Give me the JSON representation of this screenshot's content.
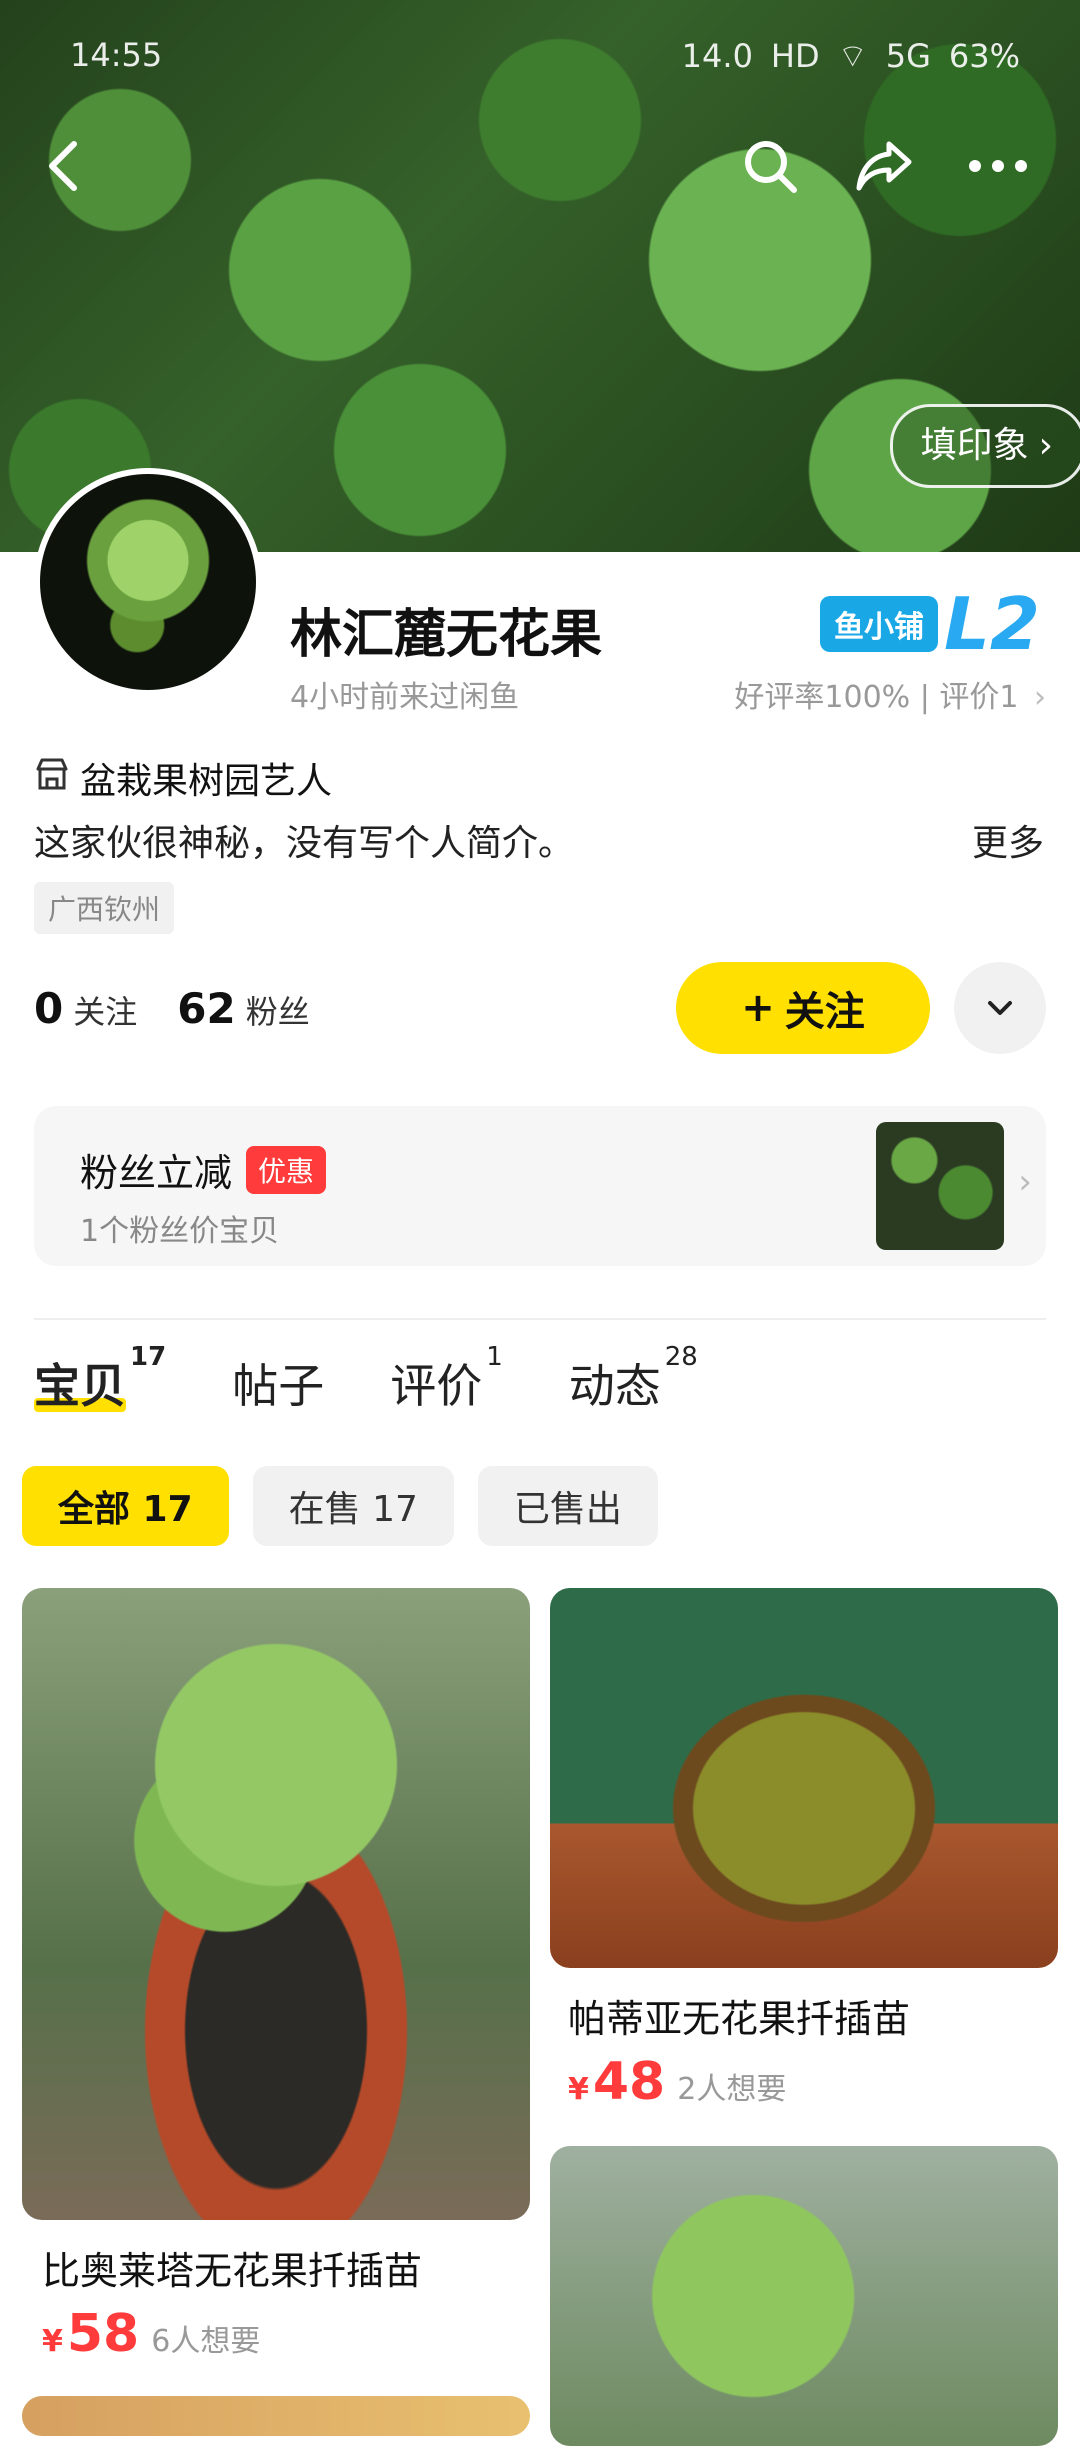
{
  "status_bar": {
    "time": "14:55",
    "net_speed": "14.0",
    "hd": "HD",
    "signal": "5G",
    "battery": "63%"
  },
  "header": {
    "imprint_label": "填印象",
    "imprint_chevron": "›"
  },
  "profile": {
    "name": "林汇麓无花果",
    "last_visit": "4小时前来过闲鱼",
    "store_badge": "鱼小铺",
    "store_level": "L2",
    "rating": "好评率100% | 评价1",
    "rating_chevron": "›",
    "tag": "盆栽果树园艺人",
    "bio": "这家伙很神秘，没有写个人简介。",
    "more_label": "更多",
    "location": "广西钦州"
  },
  "stats": {
    "following_count": "0",
    "following_label": "关注",
    "fans_count": "62",
    "fans_label": "粉丝"
  },
  "follow_button": {
    "plus": "+",
    "label": "关注"
  },
  "promo": {
    "title": "粉丝立减",
    "badge": "优惠",
    "subtitle": "1个粉丝价宝贝",
    "chevron": "›"
  },
  "tabs": [
    {
      "label": "宝贝",
      "count": "17"
    },
    {
      "label": "帖子",
      "count": ""
    },
    {
      "label": "评价",
      "count": "1"
    },
    {
      "label": "动态",
      "count": "28"
    }
  ],
  "filters": [
    {
      "label": "全部 17"
    },
    {
      "label": "在售 17"
    },
    {
      "label": "已售出"
    }
  ],
  "products": [
    {
      "title": "比奥莱塔无花果扦插苗",
      "currency": "¥",
      "price": "58",
      "wants": "6人想要"
    },
    {
      "title": "帕蒂亚无花果扦插苗",
      "currency": "¥",
      "price": "48",
      "wants": "2人想要"
    }
  ],
  "colors": {
    "accent": "#ffe000",
    "price": "#ff3b3b",
    "store": "#19a7e6"
  }
}
